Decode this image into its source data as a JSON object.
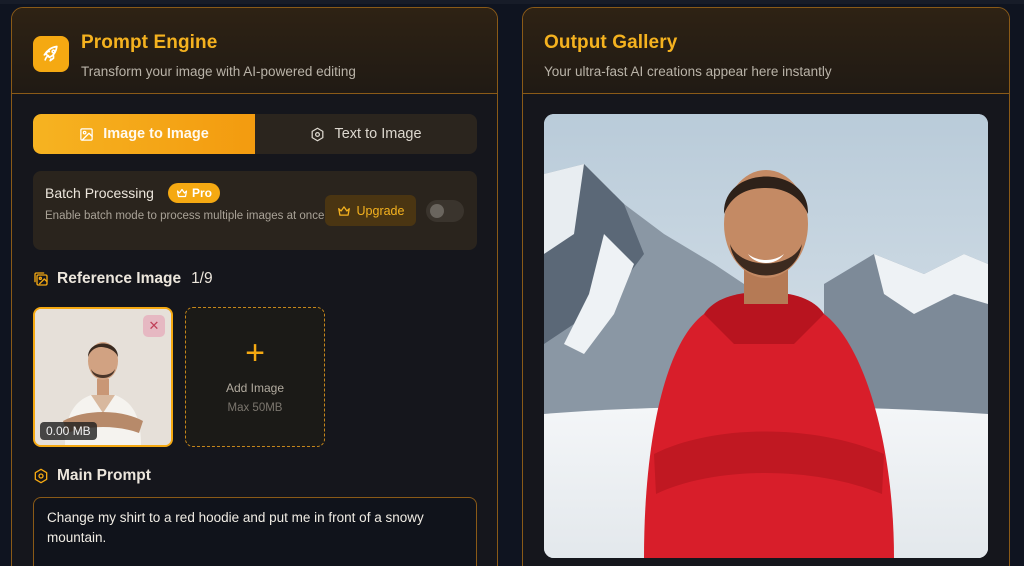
{
  "left_panel": {
    "title": "Prompt Engine",
    "subtitle": "Transform your image with AI-powered editing",
    "logo_icon": "rocket-icon"
  },
  "tabs": [
    {
      "label": "Image to Image",
      "icon": "image-icon",
      "active": true
    },
    {
      "label": "Text to Image",
      "icon": "hexagon-icon",
      "active": false
    }
  ],
  "batch": {
    "title": "Batch Processing",
    "badge": "Pro",
    "description": "Enable batch mode to process multiple images at once",
    "upgrade_label": "Upgrade",
    "enabled": false
  },
  "reference": {
    "title": "Reference Image",
    "count": "1/9",
    "images": [
      {
        "size": "0.00 MB"
      }
    ],
    "add_label": "Add Image",
    "add_sub": "Max 50MB"
  },
  "prompt": {
    "title": "Main Prompt",
    "value": "Change my shirt to a red hoodie and put me in front of a snowy mountain."
  },
  "right_panel": {
    "title": "Output Gallery",
    "subtitle": "Your ultra-fast AI creations appear here instantly"
  },
  "colors": {
    "accent": "#f5a912",
    "border": "#8a5a17",
    "background": "#0f1420"
  }
}
